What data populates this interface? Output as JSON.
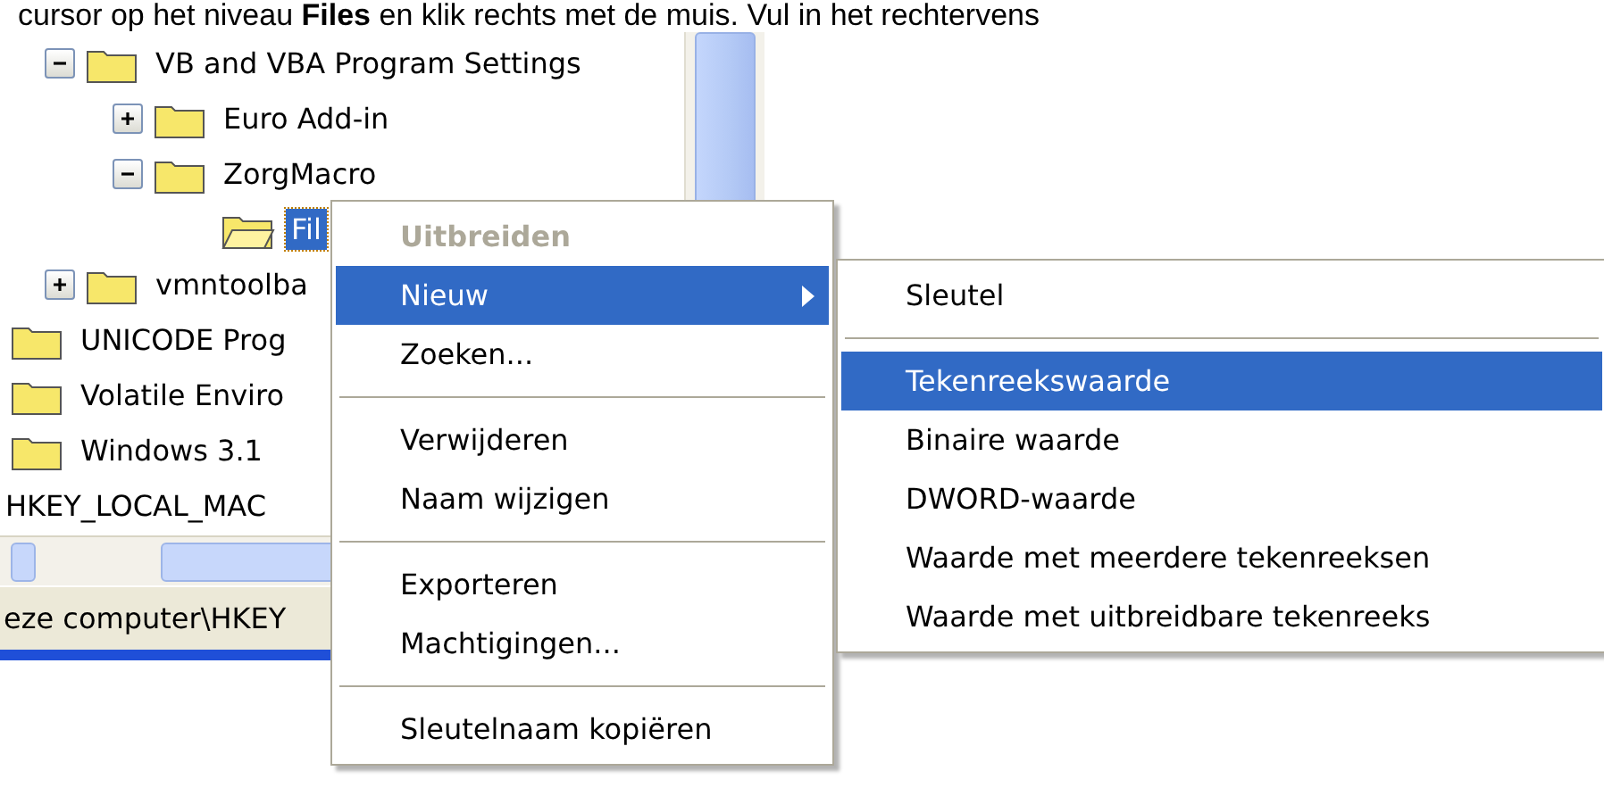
{
  "instruction": "cursor op het niveau **Files** en klik rechts met de muis. Vul in het rechtervens",
  "tree": {
    "items": [
      {
        "label": "VB and VBA Program Settings",
        "expanded": true,
        "selected": false,
        "children": [
          {
            "label": "Euro Add-in",
            "expanded": false,
            "selected": false
          },
          {
            "label": "ZorgMacro",
            "expanded": true,
            "selected": false,
            "children": [
              {
                "label": "Fil",
                "selected": true
              }
            ]
          }
        ]
      },
      {
        "label": "vmntoolba",
        "expanded": false,
        "selected": false
      }
    ],
    "following_items": [
      {
        "label": "UNICODE Prog",
        "kind": "folder"
      },
      {
        "label": "Volatile Enviro",
        "kind": "folder"
      },
      {
        "label": "Windows 3.1",
        "kind": "folder"
      },
      {
        "label": "HKEY_LOCAL_MAC",
        "kind": "root"
      }
    ]
  },
  "status_bar": "eze computer\\HKEY",
  "context_menu": [
    {
      "kind": "item",
      "label": "Uitbreiden",
      "disabled": true,
      "selected": false
    },
    {
      "kind": "submenu",
      "label": "Nieuw",
      "disabled": false,
      "selected": true
    },
    {
      "kind": "item",
      "label": "Zoeken...",
      "disabled": false,
      "selected": false
    },
    {
      "kind": "separator"
    },
    {
      "kind": "item",
      "label": "Verwijderen",
      "disabled": false,
      "selected": false
    },
    {
      "kind": "item",
      "label": "Naam wijzigen",
      "disabled": false,
      "selected": false
    },
    {
      "kind": "separator"
    },
    {
      "kind": "item",
      "label": "Exporteren",
      "disabled": false,
      "selected": false
    },
    {
      "kind": "item",
      "label": "Machtigingen...",
      "disabled": false,
      "selected": false
    },
    {
      "kind": "separator"
    },
    {
      "kind": "item",
      "label": "Sleutelnaam kopiëren",
      "disabled": false,
      "selected": false
    }
  ],
  "submenu": [
    {
      "kind": "item",
      "label": "Sleutel",
      "selected": false
    },
    {
      "kind": "separator"
    },
    {
      "kind": "item",
      "label": "Tekenreekswaarde",
      "selected": true
    },
    {
      "kind": "item",
      "label": "Binaire waarde",
      "selected": false
    },
    {
      "kind": "item",
      "label": "DWORD-waarde",
      "selected": false
    },
    {
      "kind": "item",
      "label": "Waarde met meerdere tekenreeksen",
      "selected": false
    },
    {
      "kind": "item",
      "label": "Waarde met uitbreidbare tekenreeks",
      "selected": false
    }
  ]
}
